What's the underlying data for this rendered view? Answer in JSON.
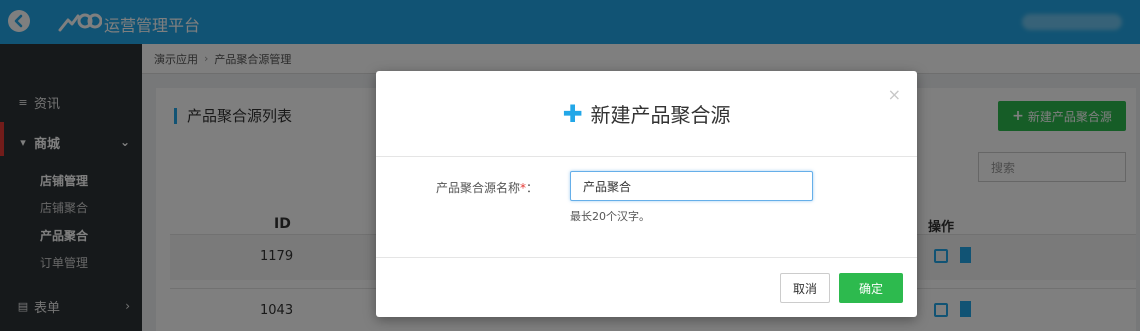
{
  "app": {
    "title": "运营管理平台"
  },
  "sidebar": {
    "items": [
      {
        "label": "资讯",
        "icon": "list-icon"
      },
      {
        "label": "商城",
        "icon": "cart-icon"
      },
      {
        "label": "表单",
        "icon": "form-icon"
      }
    ],
    "sub_items": [
      {
        "label": "店铺管理"
      },
      {
        "label": "店铺聚合"
      },
      {
        "label": "产品聚合"
      },
      {
        "label": "订单管理"
      }
    ]
  },
  "breadcrumb": {
    "items": [
      "演示应用",
      "产品聚合源管理"
    ]
  },
  "panel": {
    "title": "产品聚合源列表",
    "new_button": "新建产品聚合源",
    "search_placeholder": "搜索",
    "columns": {
      "id": "ID",
      "actions": "操作"
    },
    "rows": [
      {
        "id": "1179"
      },
      {
        "id": "1043"
      }
    ]
  },
  "modal": {
    "close": "×",
    "title": "新建产品聚合源",
    "field_label": "产品聚合源名称",
    "required_mark": "*",
    "colon": "：",
    "field_value": "产品聚合",
    "hint": "最长20个汉字。",
    "cancel": "取消",
    "confirm": "确定"
  },
  "colors": {
    "topbar": "#22a7e8",
    "sidebar": "#2c3236",
    "primary_green": "#2dba4e",
    "accent_blue": "#22a7e8"
  }
}
